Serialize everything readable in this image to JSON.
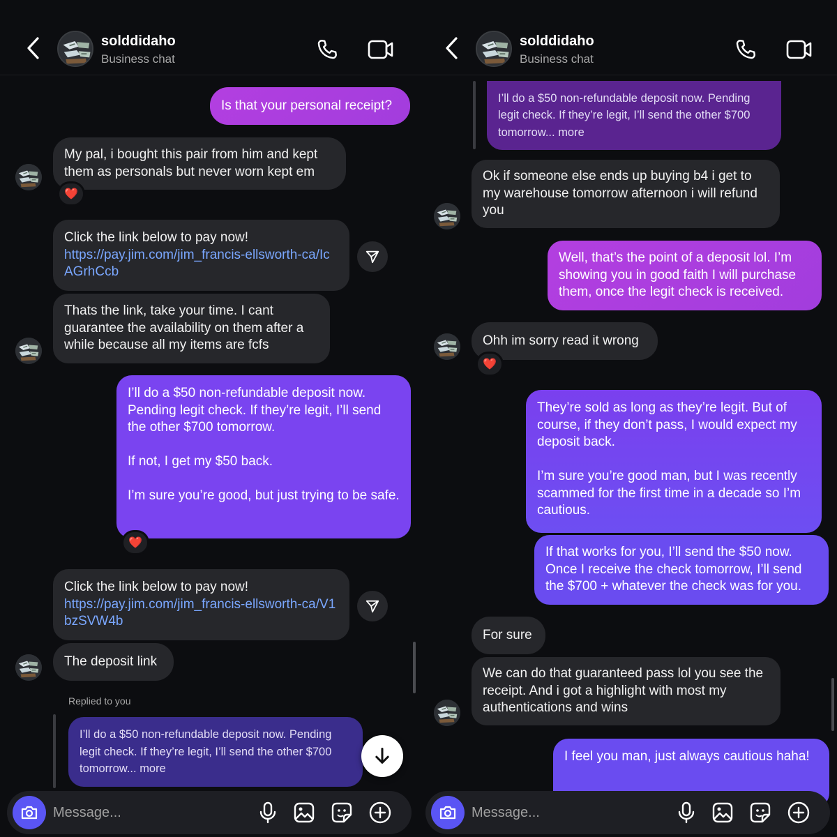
{
  "header": {
    "name": "solddidaho",
    "subtitle": "Business chat"
  },
  "composer": {
    "placeholder": "Message..."
  },
  "left_chat": {
    "messages": [
      {
        "text": "Is that your personal receipt?"
      },
      {
        "text": "My pal, i bought this pair from him and kept them as personals  but never worn kept em",
        "reaction": "❤️"
      },
      {
        "text": "Click the link below to pay now!",
        "link": "https://pay.jim.com/jim_francis-ellsworth-ca/IcAGrhCcb"
      },
      {
        "text": "Thats the link, take your time. I cant guarantee the availability on them after a while because all my items are fcfs"
      },
      {
        "text": "I’ll do a $50 non-refundable deposit now. Pending legit check. If they’re legit, I’ll send the other $700 tomorrow.\n\nIf not, I get my $50 back.\n\nI’m sure you’re good, but just trying to be safe.",
        "reaction": "❤️"
      },
      {
        "text": "Click the link below to pay now!",
        "link": "https://pay.jim.com/jim_francis-ellsworth-ca/V1bzSVW4b"
      },
      {
        "text": "The deposit link"
      }
    ],
    "reply_label": "Replied to you",
    "reply_quote": "I’ll do a $50 non-refundable deposit now. Pending legit check. If they’re legit, I’ll send the other $700 tomorrow... more"
  },
  "right_chat": {
    "top_quote": "I’ll do a $50 non-refundable deposit now. Pending legit check. If they’re legit, I’ll send the other $700 tomorrow... more",
    "messages": [
      {
        "text": "Ok if someone else ends up buying b4 i get to my warehouse tomorrow afternoon i will refund you"
      },
      {
        "text": "Well, that’s the point of a deposit lol. I’m showing you in good faith I will purchase them, once the legit check is received."
      },
      {
        "text": "Ohh im sorry read it wrong",
        "reaction": "❤️"
      },
      {
        "text": "They’re sold as long as they’re legit. But of course, if they don’t pass, I would expect my deposit back.\n\nI’m sure you’re good man, but I was recently scammed for the first time in a decade so I’m cautious."
      },
      {
        "text": "If that works for you, I’ll send the $50 now. Once I receive the check tomorrow, I’ll send the $700 + whatever the check was for you."
      },
      {
        "text": "For sure"
      },
      {
        "text": "We can do that guaranteed pass lol you see the receipt. And i got a highlight with most my authentications and wins"
      },
      {
        "text": "I feel you man, just always cautious haha!"
      }
    ]
  },
  "icons": {
    "back": "chevron-left-icon",
    "call": "phone-icon",
    "video": "video-camera-icon",
    "share": "send-icon",
    "scroll": "arrow-down-icon",
    "camera": "camera-icon",
    "mic": "microphone-icon",
    "gallery": "image-icon",
    "sticker": "sticker-icon",
    "plus": "plus-icon"
  },
  "colors": {
    "background": "#0c0d10",
    "incoming_bubble": "#26272b",
    "outgoing_pink": "#b33fe0",
    "outgoing_purple": "#7a44f0",
    "link": "#7aa7ff",
    "camera_button": "#5a55f4"
  }
}
